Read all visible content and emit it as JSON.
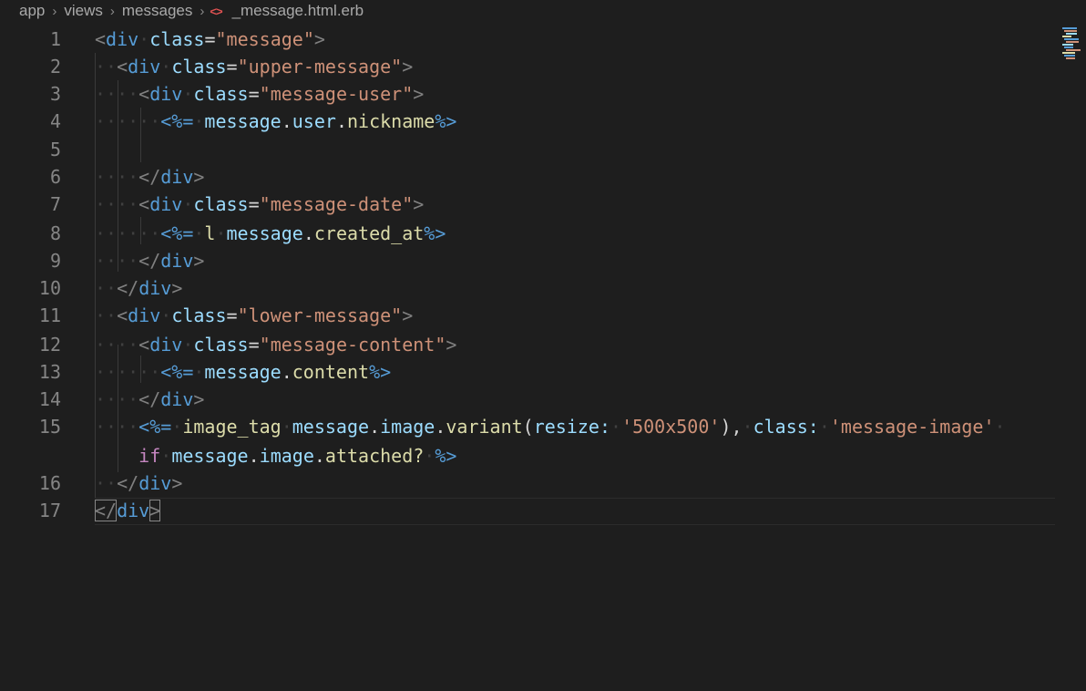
{
  "breadcrumb": {
    "items": [
      "app",
      "views",
      "messages"
    ],
    "separator": "›",
    "file_icon": "<>",
    "file_name": "_message.html.erb"
  },
  "editor": {
    "line_numbers": [
      "1",
      "2",
      "3",
      "4",
      "5",
      "6",
      "7",
      "8",
      "9",
      "10",
      "11",
      "12",
      "13",
      "14",
      "15",
      "",
      "16",
      "17"
    ],
    "lines": [
      [
        [
          "ws",
          ""
        ],
        [
          "t-bracket",
          "<"
        ],
        [
          "t-tag",
          "div"
        ],
        [
          "ws",
          "·"
        ],
        [
          "t-attr",
          "class"
        ],
        [
          "t-plain",
          "="
        ],
        [
          "t-str",
          "\"message\""
        ],
        [
          "t-bracket",
          ">"
        ]
      ],
      [
        [
          "ws",
          "··"
        ],
        [
          "t-bracket",
          "<"
        ],
        [
          "t-tag",
          "div"
        ],
        [
          "ws",
          "·"
        ],
        [
          "t-attr",
          "class"
        ],
        [
          "t-plain",
          "="
        ],
        [
          "t-str",
          "\"upper-message\""
        ],
        [
          "t-bracket",
          ">"
        ]
      ],
      [
        [
          "ws",
          "····"
        ],
        [
          "t-bracket",
          "<"
        ],
        [
          "t-tag",
          "div"
        ],
        [
          "ws",
          "·"
        ],
        [
          "t-attr",
          "class"
        ],
        [
          "t-plain",
          "="
        ],
        [
          "t-str",
          "\"message-user\""
        ],
        [
          "t-bracket",
          ">"
        ]
      ],
      [
        [
          "ws",
          "······"
        ],
        [
          "t-erb",
          "<%="
        ],
        [
          "ws",
          "·"
        ],
        [
          "t-var",
          "message"
        ],
        [
          "t-plain",
          "."
        ],
        [
          "t-var",
          "user"
        ],
        [
          "t-plain",
          "."
        ],
        [
          "t-func",
          "nickname"
        ],
        [
          "t-erb",
          "%>"
        ]
      ],
      [
        [
          "ws",
          ""
        ]
      ],
      [
        [
          "ws",
          "····"
        ],
        [
          "t-bracket",
          "</"
        ],
        [
          "t-tag",
          "div"
        ],
        [
          "t-bracket",
          ">"
        ]
      ],
      [
        [
          "ws",
          "····"
        ],
        [
          "t-bracket",
          "<"
        ],
        [
          "t-tag",
          "div"
        ],
        [
          "ws",
          "·"
        ],
        [
          "t-attr",
          "class"
        ],
        [
          "t-plain",
          "="
        ],
        [
          "t-str",
          "\"message-date\""
        ],
        [
          "t-bracket",
          ">"
        ]
      ],
      [
        [
          "ws",
          "······"
        ],
        [
          "t-erb",
          "<%="
        ],
        [
          "ws",
          "·"
        ],
        [
          "t-func",
          "l"
        ],
        [
          "ws",
          "·"
        ],
        [
          "t-var",
          "message"
        ],
        [
          "t-plain",
          "."
        ],
        [
          "t-func",
          "created_at"
        ],
        [
          "t-erb",
          "%>"
        ]
      ],
      [
        [
          "ws",
          "····"
        ],
        [
          "t-bracket",
          "</"
        ],
        [
          "t-tag",
          "div"
        ],
        [
          "t-bracket",
          ">"
        ]
      ],
      [
        [
          "ws",
          "··"
        ],
        [
          "t-bracket",
          "</"
        ],
        [
          "t-tag",
          "div"
        ],
        [
          "t-bracket",
          ">"
        ]
      ],
      [
        [
          "ws",
          "··"
        ],
        [
          "t-bracket",
          "<"
        ],
        [
          "t-tag",
          "div"
        ],
        [
          "ws",
          "·"
        ],
        [
          "t-attr",
          "class"
        ],
        [
          "t-plain",
          "="
        ],
        [
          "t-str",
          "\"lower-message\""
        ],
        [
          "t-bracket",
          ">"
        ]
      ],
      [
        [
          "ws",
          "····"
        ],
        [
          "t-bracket",
          "<"
        ],
        [
          "t-tag",
          "div"
        ],
        [
          "ws",
          "·"
        ],
        [
          "t-attr",
          "class"
        ],
        [
          "t-plain",
          "="
        ],
        [
          "t-str",
          "\"message-content\""
        ],
        [
          "t-bracket",
          ">"
        ]
      ],
      [
        [
          "ws",
          "······"
        ],
        [
          "t-erb",
          "<%="
        ],
        [
          "ws",
          "·"
        ],
        [
          "t-var",
          "message"
        ],
        [
          "t-plain",
          "."
        ],
        [
          "t-func",
          "content"
        ],
        [
          "t-erb",
          "%>"
        ]
      ],
      [
        [
          "ws",
          "····"
        ],
        [
          "t-bracket",
          "</"
        ],
        [
          "t-tag",
          "div"
        ],
        [
          "t-bracket",
          ">"
        ]
      ],
      [
        [
          "ws",
          "····"
        ],
        [
          "t-erb",
          "<%="
        ],
        [
          "ws",
          "·"
        ],
        [
          "t-func",
          "image_tag"
        ],
        [
          "ws",
          "·"
        ],
        [
          "t-var",
          "message"
        ],
        [
          "t-plain",
          "."
        ],
        [
          "t-var",
          "image"
        ],
        [
          "t-plain",
          "."
        ],
        [
          "t-func",
          "variant"
        ],
        [
          "t-plain",
          "("
        ],
        [
          "t-attr",
          "resize:"
        ],
        [
          "ws",
          "·"
        ],
        [
          "t-str",
          "'500x500'"
        ],
        [
          "t-plain",
          "),"
        ],
        [
          "ws",
          "·"
        ],
        [
          "t-attr",
          "class:"
        ],
        [
          "ws",
          "·"
        ],
        [
          "t-str",
          "'message-image'"
        ],
        [
          "ws",
          "·"
        ]
      ],
      [
        [
          "ws",
          "    "
        ],
        [
          "t-kw",
          "if"
        ],
        [
          "ws",
          "·"
        ],
        [
          "t-var",
          "message"
        ],
        [
          "t-plain",
          "."
        ],
        [
          "t-var",
          "image"
        ],
        [
          "t-plain",
          "."
        ],
        [
          "t-func",
          "attached?"
        ],
        [
          "ws",
          "·"
        ],
        [
          "t-erb",
          "%>"
        ]
      ],
      [
        [
          "ws",
          "··"
        ],
        [
          "t-bracket",
          "</"
        ],
        [
          "t-tag",
          "div"
        ],
        [
          "t-bracket",
          ">"
        ]
      ],
      [
        [
          "ws",
          ""
        ],
        [
          "t-bracket",
          "</"
        ],
        [
          "t-tag",
          "div"
        ],
        [
          "t-bracket",
          ">"
        ]
      ]
    ]
  }
}
